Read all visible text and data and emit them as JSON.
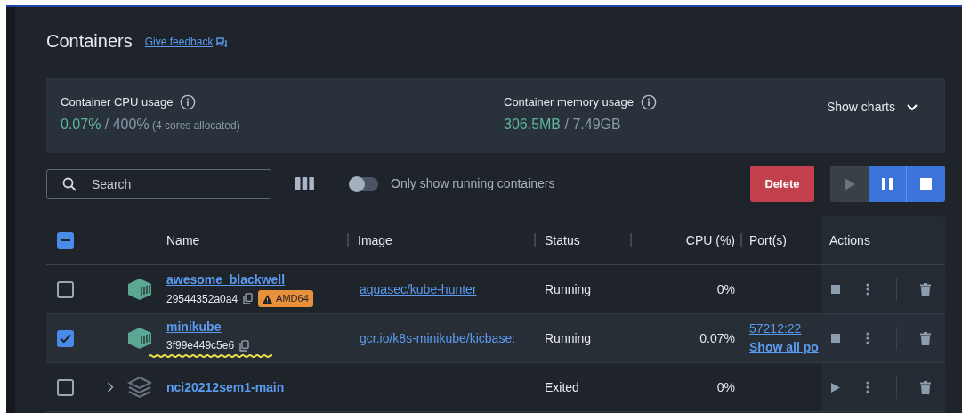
{
  "page": {
    "title": "Containers",
    "feedback_link": "Give feedback"
  },
  "stats": [
    {
      "label": "Container CPU usage",
      "used": "0.07%",
      "total": "/ 400%",
      "note": "(4 cores allocated)"
    },
    {
      "label": "Container memory usage",
      "used": "306.5MB",
      "total": "/ 7.49GB"
    }
  ],
  "show_charts": {
    "label": "Show charts",
    "expanded": false
  },
  "toolbar": {
    "search": {
      "placeholder": "Search"
    },
    "running_only": {
      "label": "Only show running containers",
      "on": false
    },
    "delete_button": "Delete",
    "start_disabled": true,
    "pause_disabled": false,
    "stop_disabled": false
  },
  "table": {
    "select_all": {
      "indeterminate": true
    },
    "columns": [
      "Name",
      "Image",
      "Status",
      "CPU (%)",
      "Port(s)",
      "Actions"
    ],
    "rows": [
      {
        "kind": "container",
        "selected": false,
        "name": "awesome_blackwell",
        "id": "29544352a0a4",
        "badge": "AMD64",
        "image": "aquasec/kube-hunter",
        "status": "Running",
        "running": true,
        "cpu": "0%"
      },
      {
        "kind": "container",
        "selected": true,
        "name": "minikube",
        "id": "3f99e449c5e6",
        "highlighted": true,
        "image": "gcr.io/k8s-minikube/kicbase:",
        "status": "Running",
        "running": true,
        "cpu": "0.07%",
        "port": "57212:22",
        "ports_link": "Show all po"
      },
      {
        "kind": "stack",
        "selected": false,
        "expanded": false,
        "name": "nci20212sem1-main",
        "status": "Exited",
        "running": false,
        "cpu": "0%"
      }
    ]
  }
}
